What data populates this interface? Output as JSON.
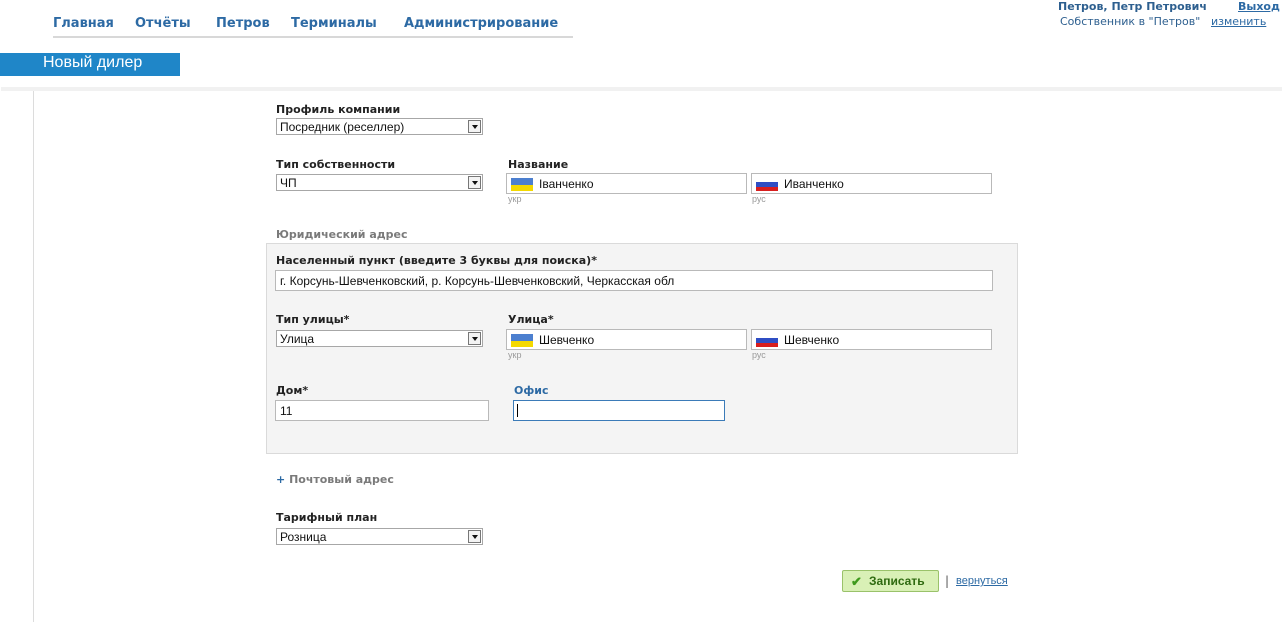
{
  "nav": {
    "items": [
      "Главная",
      "Отчёты",
      "Петров",
      "Терминалы",
      "Администрирование"
    ]
  },
  "user": {
    "name": "Петров, Петр Петрович",
    "logout": "Выход",
    "role": "Собственник в \"Петров\"",
    "change": "изменить"
  },
  "page_title": "Новый дилер",
  "form": {
    "company_profile": {
      "label": "Профиль компании",
      "value": "Посредник (реселлер)"
    },
    "ownership_type": {
      "label": "Тип собственности",
      "value": "ЧП"
    },
    "name": {
      "label": "Название",
      "ukr_value": "Іванченко",
      "rus_value": "Иванченко",
      "ukr_hint": "укр",
      "rus_hint": "рус"
    },
    "legal_address": {
      "section_label": "Юридический адрес",
      "locality": {
        "label": "Населенный пункт (введите 3 буквы для поиска)*",
        "value": "г. Корсунь-Шевченковский, р. Корсунь-Шевченковский, Черкасская обл"
      },
      "street_type": {
        "label": "Тип улицы*",
        "value": "Улица"
      },
      "street": {
        "label": "Улица*",
        "ukr_value": "Шевченко",
        "rus_value": "Шевченко",
        "ukr_hint": "укр",
        "rus_hint": "рус"
      },
      "house": {
        "label": "Дом*",
        "value": "11"
      },
      "office": {
        "label": "Офис",
        "value": ""
      }
    },
    "postal_address_link": {
      "plus": "+",
      "label": "Почтовый адрес"
    },
    "tariff_plan": {
      "label": "Тарифный план",
      "value": "Розница"
    },
    "save_label": "Записать",
    "separator": "|",
    "back_label": "вернуться"
  },
  "colors": {
    "accent": "#1f86c8",
    "link": "#2d6aa4",
    "save_bg": "#d9f0b6"
  },
  "icons": {
    "ukr_flag": "ukraine-flag-icon",
    "rus_flag": "russia-flag-icon",
    "save_check": "checkmark-icon",
    "select_arrow": "chevron-down-icon"
  }
}
